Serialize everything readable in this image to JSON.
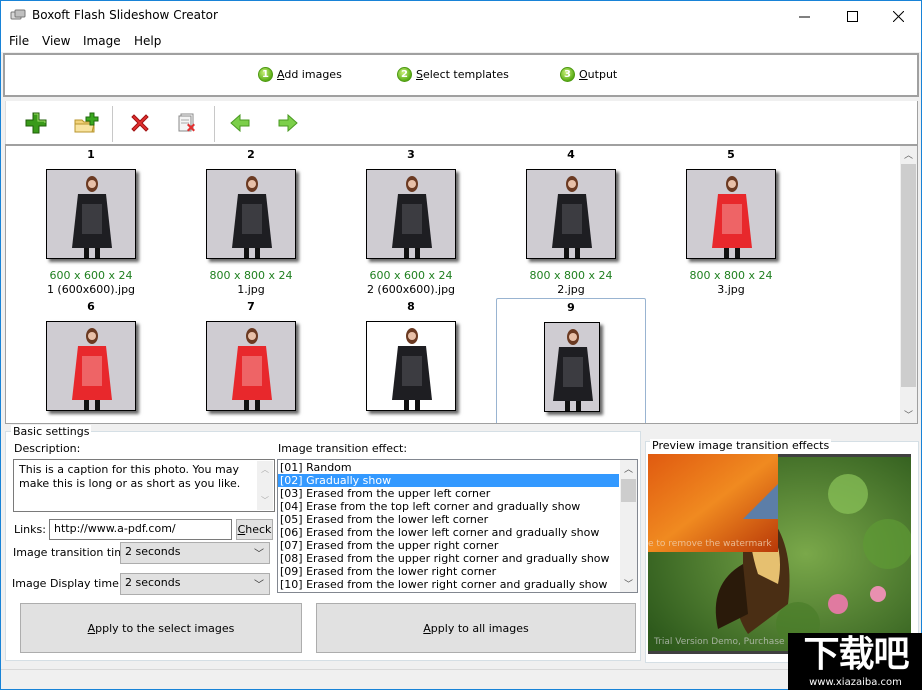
{
  "window": {
    "title": "Boxoft Flash Slideshow Creator",
    "controls": {
      "minimize": "—",
      "maximize": "☐",
      "close": "✕"
    }
  },
  "menu": [
    "File",
    "View",
    "Image",
    "Help"
  ],
  "steps": [
    {
      "num": "1",
      "accel": "A",
      "rest": "dd images"
    },
    {
      "num": "2",
      "accel": "S",
      "rest": "elect templates"
    },
    {
      "num": "3",
      "accel": "O",
      "rest": "utput"
    }
  ],
  "toolbar": {
    "buttons": [
      "add-image",
      "add-folder",
      "delete",
      "clear-all",
      "move-left",
      "move-right"
    ]
  },
  "gallery": {
    "items": [
      {
        "num": "1",
        "dims": "600 x 600 x 24",
        "file": "1 (600x600).jpg",
        "dress": "black",
        "bg": "gray"
      },
      {
        "num": "2",
        "dims": "800 x 800 x 24",
        "file": "1.jpg",
        "dress": "black",
        "bg": "gray"
      },
      {
        "num": "3",
        "dims": "600 x 600 x 24",
        "file": "2 (600x600).jpg",
        "dress": "black",
        "bg": "gray"
      },
      {
        "num": "4",
        "dims": "800 x 800 x 24",
        "file": "2.jpg",
        "dress": "black",
        "bg": "gray"
      },
      {
        "num": "5",
        "dims": "800 x 800 x 24",
        "file": "3.jpg",
        "dress": "red",
        "bg": "gray"
      },
      {
        "num": "6",
        "dims": "",
        "file": "",
        "dress": "red",
        "bg": "gray"
      },
      {
        "num": "7",
        "dims": "",
        "file": "",
        "dress": "red",
        "bg": "gray"
      },
      {
        "num": "8",
        "dims": "",
        "file": "",
        "dress": "black",
        "bg": "white"
      },
      {
        "num": "9",
        "dims": "",
        "file": "",
        "dress": "black",
        "bg": "gray"
      }
    ],
    "selected_index": 8
  },
  "settings": {
    "group_title": "Basic settings",
    "description_label": "Description:",
    "description_value": "This is a caption for this photo. You may make this is long or as short as you like.",
    "links_label": "Links:",
    "links_value": "http://www.a-pdf.com/",
    "check_accel": "C",
    "check_rest": "heck",
    "transition_time_label": "Image transition time:",
    "transition_time_value": "2 seconds",
    "display_time_label": "Image Display time:",
    "display_time_value": "2 seconds",
    "effect_label": "Image transition effect:",
    "effects": [
      "[01] Random",
      "[02] Gradually show",
      "[03] Erased from the upper left corner",
      "[04] Erase from the top left corner and gradually show",
      "[05] Erased from the lower left corner",
      "[06] Erased from the lower left corner and gradually show",
      "[07] Erased from the upper right corner",
      "[08] Erased from the upper right corner and gradually show",
      "[09] Erased from the lower right corner",
      "[10] Erased from the lower right corner and gradually show"
    ],
    "selected_effect": 1,
    "apply_selected_accel": "A",
    "apply_selected_rest": "pply to the select images",
    "apply_all_accel": "A",
    "apply_all_rest": "pply to all images"
  },
  "preview": {
    "title": "Preview image transition effects",
    "watermark_top": "e to remove the watermark",
    "watermark_bottom": "Trial Version Demo, Purchase"
  },
  "site_watermark": {
    "logo": "下载吧",
    "url": "www.xiazaiba.com"
  }
}
